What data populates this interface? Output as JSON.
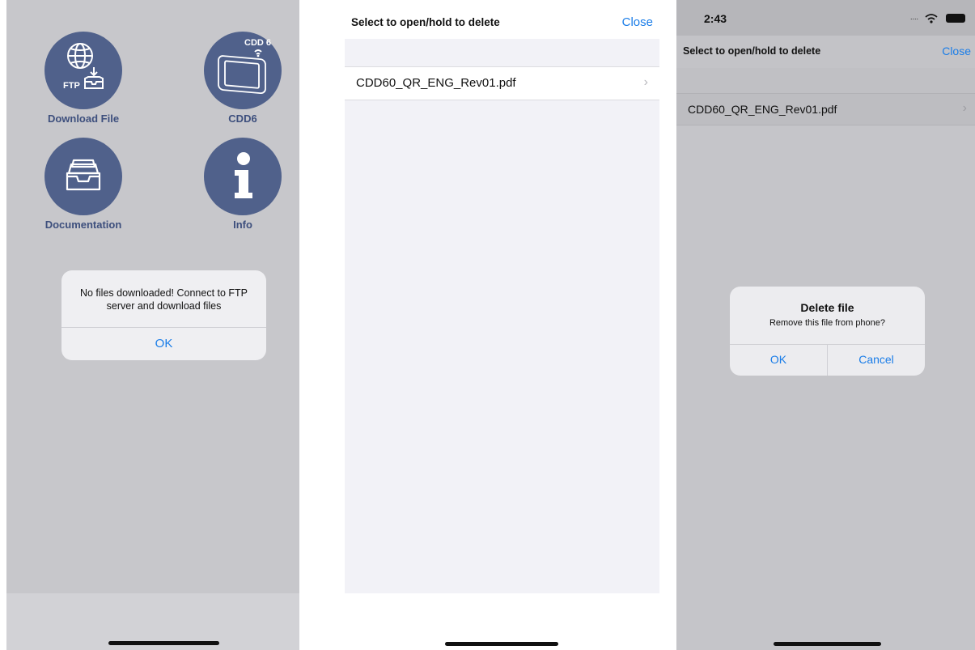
{
  "screen1": {
    "tiles": [
      {
        "label": "Download File",
        "icon": "ftp-download-icon",
        "badge": "FTP"
      },
      {
        "label": "CDD6",
        "icon": "cdd6-device-icon",
        "badge": "CDD 6"
      },
      {
        "label": "Documentation",
        "icon": "inbox-tray-icon"
      },
      {
        "label": "Info",
        "icon": "info-icon"
      }
    ],
    "alert": {
      "message": "No files downloaded! Connect to FTP server and download files",
      "ok": "OK"
    }
  },
  "screen2": {
    "nav": {
      "title": "Select to open/hold to delete",
      "close": "Close"
    },
    "files": [
      {
        "name": "CDD60_QR_ENG_Rev01.pdf"
      }
    ]
  },
  "screen3": {
    "status": {
      "time": "2:43"
    },
    "nav": {
      "title": "Select to open/hold to delete",
      "close": "Close"
    },
    "files": [
      {
        "name": "CDD60_QR_ENG_Rev01.pdf"
      }
    ],
    "alert": {
      "title": "Delete file",
      "message": "Remove this file from phone?",
      "ok": "OK",
      "cancel": "Cancel"
    }
  },
  "colors": {
    "accent": "#1a7de8",
    "tile_circle": "#50618b",
    "tile_label": "#3d4f7d"
  }
}
